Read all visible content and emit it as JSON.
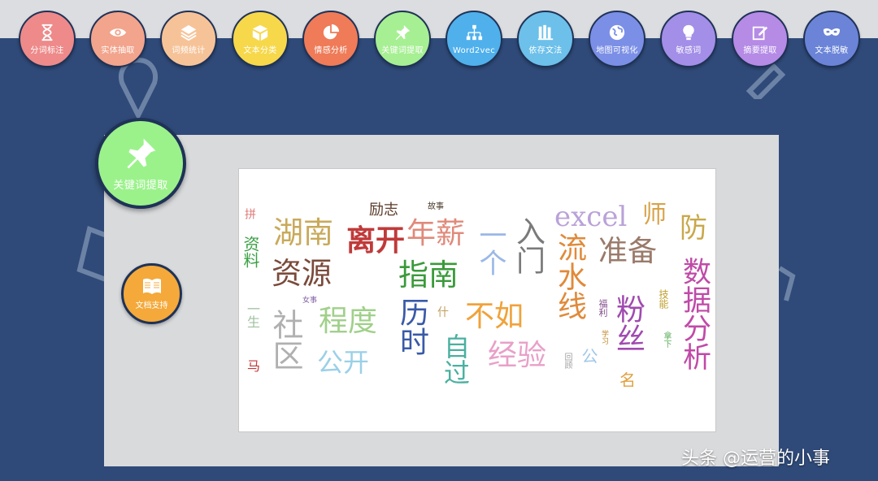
{
  "toolbar": {
    "items": [
      {
        "label": "分词标注",
        "icon": "hourglass-icon",
        "color": "#ee8a8a"
      },
      {
        "label": "实体抽取",
        "icon": "eye-icon",
        "color": "#f2a48c"
      },
      {
        "label": "词频统计",
        "icon": "layers-icon",
        "color": "#f6c398"
      },
      {
        "label": "文本分类",
        "icon": "box-icon",
        "color": "#f6d84a"
      },
      {
        "label": "情感分析",
        "icon": "pie-chart-icon",
        "color": "#ef7b58"
      },
      {
        "label": "关键词提取",
        "icon": "pushpin-icon",
        "color": "#a7ef93"
      },
      {
        "label": "Word2vec",
        "icon": "network-icon",
        "color": "#4fb0ec"
      },
      {
        "label": "依存文法",
        "icon": "books-icon",
        "color": "#6cc0ea"
      },
      {
        "label": "地图可视化",
        "icon": "globe-icon",
        "color": "#7b8fe6"
      },
      {
        "label": "敏感词",
        "icon": "lightbulb-icon",
        "color": "#a38ee8"
      },
      {
        "label": "摘要提取",
        "icon": "edit-icon",
        "color": "#b58be6"
      },
      {
        "label": "文本脱敏",
        "icon": "mask-icon",
        "color": "#6b84d8"
      }
    ]
  },
  "active_feature": {
    "label": "关键词提取",
    "icon": "pushpin-icon",
    "color": "#9bf28b"
  },
  "doc_support": {
    "label": "文档支持",
    "icon": "book-icon",
    "color": "#f4a93a"
  },
  "wordcloud": {
    "words": [
      {
        "text": "拼",
        "color": "#e07a7a"
      },
      {
        "text": "资料",
        "color": "#3aa044"
      },
      {
        "text": "湖南",
        "color": "#c9a95a"
      },
      {
        "text": "资源",
        "color": "#7a4a3a"
      },
      {
        "text": "离开",
        "color": "#c03a3a"
      },
      {
        "text": "励志",
        "color": "#5a3a2a"
      },
      {
        "text": "故事",
        "color": "#4a3a2a"
      },
      {
        "text": "年薪",
        "color": "#e08a7a"
      },
      {
        "text": "指南",
        "color": "#3a9a3a"
      },
      {
        "text": "一个",
        "color": "#9ab8e8"
      },
      {
        "text": "入门",
        "color": "#7a7a7a"
      },
      {
        "text": "excel",
        "color": "#b9a2d8"
      },
      {
        "text": "师",
        "color": "#d9a24a"
      },
      {
        "text": "防",
        "color": "#c9a84a"
      },
      {
        "text": "流水线",
        "color": "#e08a3a"
      },
      {
        "text": "准备",
        "color": "#9a7a6a"
      },
      {
        "text": "数据分析",
        "color": "#c04aa8"
      },
      {
        "text": "程度",
        "color": "#a0d08a"
      },
      {
        "text": "社区",
        "color": "#b0b0b0"
      },
      {
        "text": "公开",
        "color": "#9ad0e8"
      },
      {
        "text": "历时",
        "color": "#3a5aa8"
      },
      {
        "text": "不如",
        "color": "#f0a23a"
      },
      {
        "text": "经验",
        "color": "#e8a0c8"
      },
      {
        "text": "自过",
        "color": "#4ab0a0"
      },
      {
        "text": "粉丝",
        "color": "#a04ab0"
      },
      {
        "text": "一生",
        "color": "#a0c0a0"
      },
      {
        "text": "马",
        "color": "#c03a3a"
      },
      {
        "text": "公",
        "color": "#a0c8e8"
      },
      {
        "text": "技能",
        "color": "#c0a030"
      },
      {
        "text": "福利",
        "color": "#804a8a"
      },
      {
        "text": "学习",
        "color": "#c08a2a"
      },
      {
        "text": "拿下",
        "color": "#60b060"
      },
      {
        "text": "回顾",
        "color": "#a0a0a0"
      },
      {
        "text": "什",
        "color": "#c0a060"
      },
      {
        "text": "女事",
        "color": "#8060a0"
      },
      {
        "text": "名",
        "color": "#e0a040"
      }
    ]
  },
  "watermark": {
    "text": "头条 @运营的小事"
  }
}
